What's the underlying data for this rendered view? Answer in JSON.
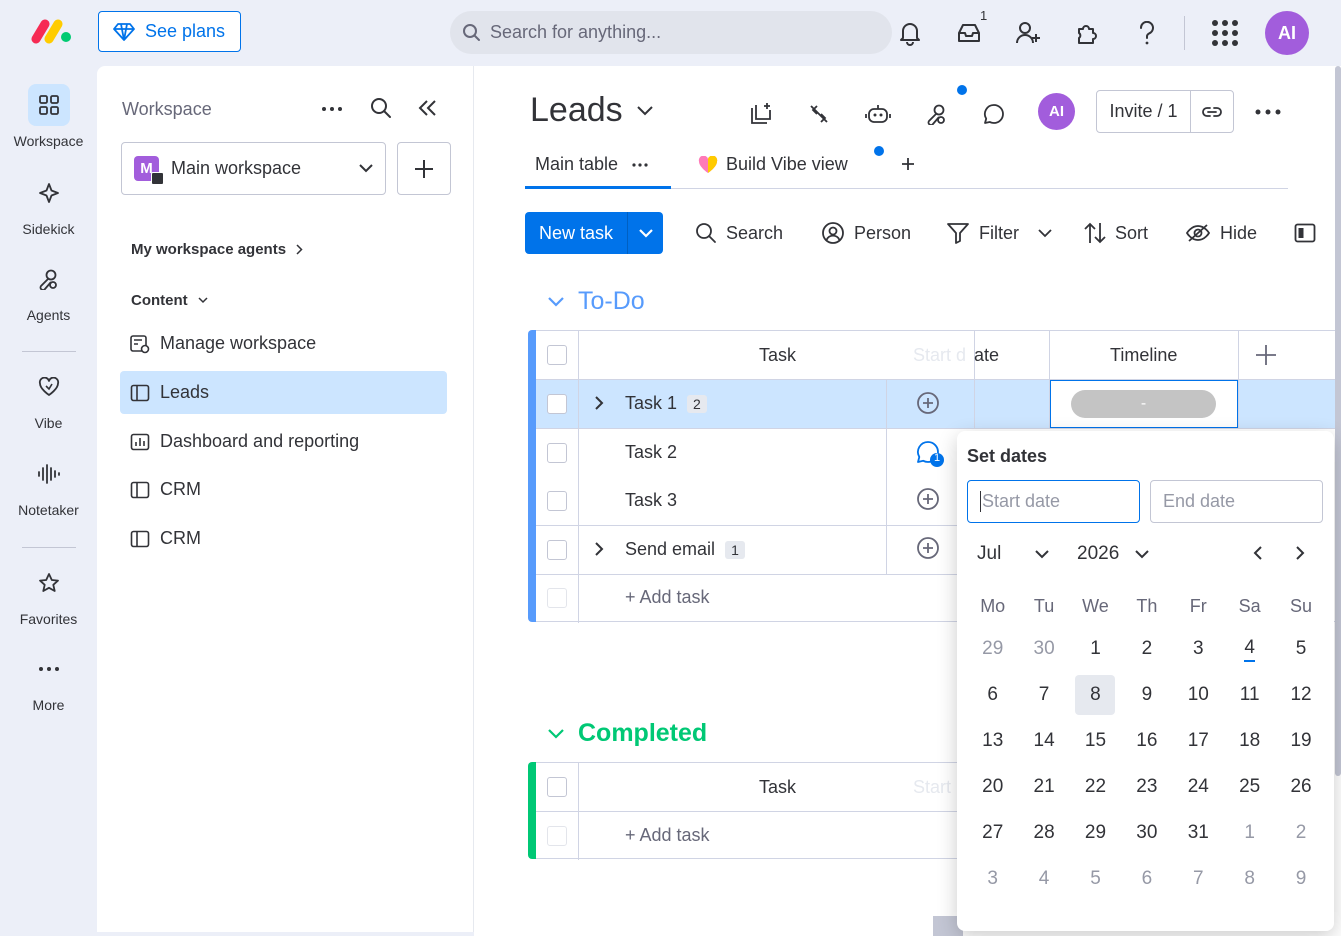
{
  "topbar": {
    "see_plans_label": "See plans",
    "search_placeholder": "Search for anything...",
    "inbox_badge": "1",
    "avatar_initials": "AI"
  },
  "rail": {
    "items": [
      {
        "label": "Workspace",
        "icon": "grid-icon"
      },
      {
        "label": "Sidekick",
        "icon": "sparkle-icon"
      },
      {
        "label": "Agents",
        "icon": "agents-icon"
      },
      {
        "label": "Vibe",
        "icon": "heart-icon"
      },
      {
        "label": "Notetaker",
        "icon": "waveform-icon"
      },
      {
        "label": "Favorites",
        "icon": "star-icon"
      },
      {
        "label": "More",
        "icon": "more-dots-icon"
      }
    ]
  },
  "sidebar": {
    "title": "Workspace",
    "workspace_letter": "M",
    "workspace_name": "Main workspace",
    "agents_link": "My workspace agents",
    "content_label": "Content",
    "items": [
      {
        "label": "Manage workspace",
        "icon": "manage-icon"
      },
      {
        "label": "Leads",
        "icon": "board-icon"
      },
      {
        "label": "Dashboard and reporting",
        "icon": "dashboard-icon"
      },
      {
        "label": "CRM",
        "icon": "board-icon"
      },
      {
        "label": "CRM",
        "icon": "board-icon"
      }
    ]
  },
  "board": {
    "title": "Leads",
    "avatar_initials": "AI",
    "invite_label": "Invite / 1",
    "tabs": [
      {
        "label": "Main table"
      },
      {
        "label": "Build Vibe view"
      }
    ],
    "toolbar": {
      "new_task": "New task",
      "search": "Search",
      "person": "Person",
      "filter": "Filter",
      "sort": "Sort",
      "hide": "Hide"
    }
  },
  "groups": {
    "todo": {
      "title": "To-Do",
      "color": "#579bfc",
      "header_task": "Task",
      "header_start_faded": "Start d",
      "header_date": "ate",
      "header_timeline": "Timeline",
      "timeline_value": "-",
      "rows": [
        {
          "name": "Task 1",
          "count": "2",
          "expandable": true,
          "selected": true
        },
        {
          "name": "Task 2",
          "count": "",
          "expandable": false,
          "comments": "1"
        },
        {
          "name": "Task 3",
          "count": "",
          "expandable": false
        },
        {
          "name": "Send email",
          "count": "1",
          "expandable": true
        }
      ],
      "add_task": "+ Add task"
    },
    "completed": {
      "title": "Completed",
      "color": "#00c875",
      "header_task": "Task",
      "header_start_faded": "Start",
      "add_task": "+ Add task"
    }
  },
  "datepicker": {
    "title": "Set dates",
    "start_placeholder": "Start date",
    "end_placeholder": "End date",
    "month": "Jul",
    "year": "2026",
    "weekdays": [
      "Mo",
      "Tu",
      "We",
      "Th",
      "Fr",
      "Sa",
      "Su"
    ],
    "days": [
      {
        "d": "29",
        "muted": true
      },
      {
        "d": "30",
        "muted": true
      },
      {
        "d": "1"
      },
      {
        "d": "2"
      },
      {
        "d": "3"
      },
      {
        "d": "4",
        "today": true
      },
      {
        "d": "5"
      },
      {
        "d": "6"
      },
      {
        "d": "7"
      },
      {
        "d": "8",
        "selected": true
      },
      {
        "d": "9"
      },
      {
        "d": "10"
      },
      {
        "d": "11"
      },
      {
        "d": "12"
      },
      {
        "d": "13"
      },
      {
        "d": "14"
      },
      {
        "d": "15"
      },
      {
        "d": "16"
      },
      {
        "d": "17"
      },
      {
        "d": "18"
      },
      {
        "d": "19"
      },
      {
        "d": "20"
      },
      {
        "d": "21"
      },
      {
        "d": "22"
      },
      {
        "d": "23"
      },
      {
        "d": "24"
      },
      {
        "d": "25"
      },
      {
        "d": "26"
      },
      {
        "d": "27"
      },
      {
        "d": "28"
      },
      {
        "d": "29"
      },
      {
        "d": "30"
      },
      {
        "d": "31"
      },
      {
        "d": "1",
        "muted": true
      },
      {
        "d": "2",
        "muted": true
      },
      {
        "d": "3",
        "muted": true
      },
      {
        "d": "4",
        "muted": true
      },
      {
        "d": "5",
        "muted": true
      },
      {
        "d": "6",
        "muted": true
      },
      {
        "d": "7",
        "muted": true
      },
      {
        "d": "8",
        "muted": true
      },
      {
        "d": "9",
        "muted": true
      }
    ]
  }
}
